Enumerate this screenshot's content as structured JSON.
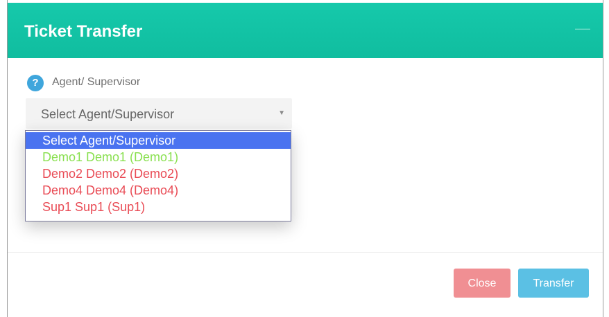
{
  "modal": {
    "title": "Ticket Transfer",
    "header_close_glyph": "—",
    "colors": {
      "header": "#10bd9f",
      "help_icon": "#3fa6dc",
      "selected_option": "#4a73f0",
      "close_button": "#f08f93",
      "transfer_button": "#5bc0e4"
    }
  },
  "field": {
    "help_icon_glyph": "?",
    "label": "Agent/ Supervisor",
    "selected_value": "Select Agent/Supervisor",
    "caret_glyph": "▼"
  },
  "dropdown": {
    "options": [
      {
        "label": "Select Agent/Supervisor",
        "color": "#ffffff",
        "selected": true
      },
      {
        "label": "Demo1 Demo1 (Demo1)",
        "color": "#89e04f",
        "selected": false
      },
      {
        "label": "Demo2 Demo2 (Demo2)",
        "color": "#e94b55",
        "selected": false
      },
      {
        "label": "Demo4 Demo4 (Demo4)",
        "color": "#e94b55",
        "selected": false
      },
      {
        "label": "Sup1 Sup1 (Sup1)",
        "color": "#e94b55",
        "selected": false
      }
    ]
  },
  "footer": {
    "close_label": "Close",
    "transfer_label": "Transfer"
  }
}
